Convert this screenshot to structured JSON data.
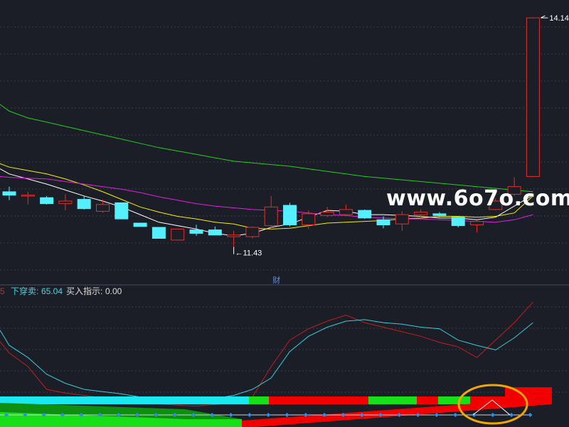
{
  "chart_data": [
    {
      "type": "candlestick",
      "panel": "main",
      "y_domain": [
        11.0,
        14.35
      ],
      "candles": [
        {
          "o": 12.09,
          "c": 12.05,
          "h": 12.15,
          "l": 11.99
        },
        {
          "o": 12.05,
          "c": 12.05,
          "h": 12.09,
          "l": 11.94
        },
        {
          "o": 12.02,
          "c": 11.95,
          "h": 12.04,
          "l": 11.94
        },
        {
          "o": 11.95,
          "c": 11.98,
          "h": 12.06,
          "l": 11.87
        },
        {
          "o": 12.0,
          "c": 11.89,
          "h": 12.04,
          "l": 11.88
        },
        {
          "o": 11.86,
          "c": 11.94,
          "h": 12.0,
          "l": 11.84
        },
        {
          "o": 11.96,
          "c": 11.77,
          "h": 11.96,
          "l": 11.77
        },
        {
          "o": 11.72,
          "c": 11.68,
          "h": 11.72,
          "l": 11.68
        },
        {
          "o": 11.67,
          "c": 11.54,
          "h": 11.67,
          "l": 11.54
        },
        {
          "o": 11.52,
          "c": 11.65,
          "h": 11.65,
          "l": 11.52
        },
        {
          "o": 11.64,
          "c": 11.6,
          "h": 11.7,
          "l": 11.57
        },
        {
          "o": 11.64,
          "c": 11.58,
          "h": 11.68,
          "l": 11.58
        },
        {
          "o": 11.56,
          "c": 11.58,
          "h": 11.63,
          "l": 11.43
        },
        {
          "o": 11.56,
          "c": 11.67,
          "h": 11.68,
          "l": 11.54
        },
        {
          "o": 11.69,
          "c": 11.91,
          "h": 12.04,
          "l": 11.64
        },
        {
          "o": 11.93,
          "c": 11.7,
          "h": 11.96,
          "l": 11.68
        },
        {
          "o": 11.7,
          "c": 11.83,
          "h": 11.87,
          "l": 11.65
        },
        {
          "o": 11.81,
          "c": 11.85,
          "h": 11.91,
          "l": 11.79
        },
        {
          "o": 11.82,
          "c": 11.88,
          "h": 11.94,
          "l": 11.82
        },
        {
          "o": 11.87,
          "c": 11.78,
          "h": 11.88,
          "l": 11.77
        },
        {
          "o": 11.76,
          "c": 11.7,
          "h": 11.8,
          "l": 11.66
        },
        {
          "o": 11.71,
          "c": 11.82,
          "h": 11.86,
          "l": 11.63
        },
        {
          "o": 11.82,
          "c": 11.85,
          "h": 11.88,
          "l": 11.78
        },
        {
          "o": 11.83,
          "c": 11.81,
          "h": 11.85,
          "l": 11.79
        },
        {
          "o": 11.79,
          "c": 11.69,
          "h": 11.8,
          "l": 11.67
        },
        {
          "o": 11.7,
          "c": 11.74,
          "h": 11.75,
          "l": 11.61
        },
        {
          "o": 11.88,
          "c": 11.98,
          "h": 12.01,
          "l": 11.87
        },
        {
          "o": 12.06,
          "c": 12.15,
          "h": 12.26,
          "l": 12.04
        },
        {
          "o": 12.27,
          "c": 14.14,
          "h": 14.14,
          "l": 12.27
        }
      ],
      "lines": [
        {
          "name": "MA5",
          "color": "#ffffff",
          "values": [
            12.3,
            12.24,
            12.18,
            12.11,
            12.04,
            11.98,
            11.91,
            11.82,
            11.73,
            11.69,
            11.65,
            11.6,
            11.57,
            11.6,
            11.67,
            11.71,
            11.79,
            11.87,
            11.86,
            11.82,
            11.82,
            11.81,
            11.8,
            11.78,
            11.78,
            11.76,
            11.79,
            11.92,
            12.05
          ]
        },
        {
          "name": "MA10",
          "color": "#f6f000",
          "values": [
            12.38,
            12.34,
            12.3,
            12.24,
            12.17,
            12.09,
            12.0,
            11.91,
            11.85,
            11.8,
            11.77,
            11.73,
            11.71,
            11.66,
            11.65,
            11.66,
            11.69,
            11.72,
            11.73,
            11.74,
            11.75,
            11.77,
            11.78,
            11.8,
            11.8,
            11.79,
            11.8,
            11.84,
            12.04
          ]
        },
        {
          "name": "MA20",
          "color": "#e020e0",
          "values": [
            12.26,
            12.25,
            12.24,
            12.21,
            12.18,
            12.15,
            12.12,
            12.08,
            12.03,
            11.99,
            11.95,
            11.92,
            11.9,
            11.88,
            11.87,
            11.86,
            11.84,
            11.82,
            11.81,
            11.79,
            11.78,
            11.77,
            11.77,
            11.76,
            11.75,
            11.74,
            11.73,
            11.76,
            11.82
          ]
        },
        {
          "name": "MA60",
          "color": "#20cf20",
          "values": [
            13.04,
            12.96,
            12.91,
            12.86,
            12.81,
            12.76,
            12.71,
            12.66,
            12.61,
            12.57,
            12.53,
            12.49,
            12.45,
            12.43,
            12.41,
            12.39,
            12.36,
            12.33,
            12.3,
            12.27,
            12.25,
            12.23,
            12.21,
            12.19,
            12.17,
            12.15,
            12.13,
            12.11,
            12.09
          ]
        }
      ],
      "annotations": [
        {
          "text": "14.14",
          "value": 14.14,
          "index": 28
        },
        {
          "text": "11.43",
          "value": 11.43,
          "index": 12
        },
        {
          "text": "财",
          "index": 14
        }
      ]
    },
    {
      "type": "line",
      "panel": "indicator",
      "legend": [
        {
          "text": "5",
          "color": "#e02020"
        },
        {
          "text": "下穿卖:",
          "color": "#40d8e8"
        },
        {
          "text": "65.04",
          "color": "#40d8e8"
        },
        {
          "text": "买入指示:",
          "color": "#dddddd"
        },
        {
          "text": "0.00",
          "color": "#dddddd"
        }
      ],
      "series": [
        {
          "color": "#c21d1d",
          "values": [
            78,
            60,
            30,
            25,
            22,
            19,
            16,
            14,
            11,
            9,
            8,
            10,
            12,
            20,
            60,
            95,
            110,
            120,
            128,
            118,
            112,
            106,
            100,
            92,
            86,
            72,
            95,
            118,
            145
          ]
        },
        {
          "color": "#3ccbd8",
          "values": [
            88,
            72,
            50,
            38,
            30,
            27,
            24,
            20,
            16,
            13,
            15,
            18,
            22,
            30,
            45,
            80,
            100,
            112,
            120,
            122,
            118,
            116,
            112,
            110,
            95,
            88,
            82,
            98,
            118
          ]
        }
      ]
    }
  ],
  "watermark": "www.6o7o.com"
}
